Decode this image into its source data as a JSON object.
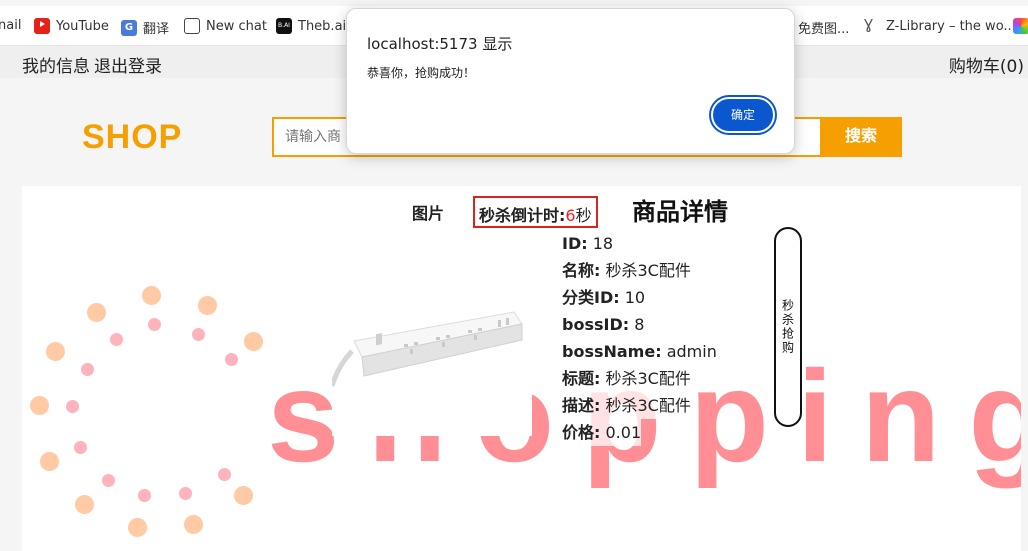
{
  "bookmarks": [
    {
      "label": "nail",
      "icon": "none"
    },
    {
      "label": "YouTube",
      "icon": "youtube-icon"
    },
    {
      "label": "翻译",
      "icon": "translate-icon"
    },
    {
      "label": "New chat",
      "icon": "chatgpt-icon"
    },
    {
      "label": "Theb.ai",
      "icon": "theb-icon"
    },
    {
      "label": "免费图...",
      "icon": "none"
    },
    {
      "label": "Z-Library – the wo...",
      "icon": "zlibrary-icon"
    },
    {
      "label": "",
      "icon": "rainbow-icon"
    }
  ],
  "topnav": {
    "my_info": "我的信息",
    "logout": "退出登录",
    "cart": "购物车(0)"
  },
  "header": {
    "logo": "SHOP",
    "search_placeholder": "请输入商",
    "search_button": "搜索"
  },
  "watermark": "shopping",
  "product": {
    "pic_label": "图片",
    "countdown_label": "秒杀倒计时:",
    "countdown_value": "6",
    "countdown_unit": "秒",
    "detail_title": "商品详情",
    "fields": [
      {
        "key": "ID:",
        "value": "18"
      },
      {
        "key": "名称:",
        "value": "秒杀3C配件"
      },
      {
        "key": "分类ID:",
        "value": "10"
      },
      {
        "key": "bossID:",
        "value": "8"
      },
      {
        "key": "bossName:",
        "value": "admin"
      },
      {
        "key": "标题:",
        "value": "秒杀3C配件"
      },
      {
        "key": "描述:",
        "value": "秒杀3C配件"
      },
      {
        "key": "价格:",
        "value": "0.01"
      }
    ],
    "buy_button": "秒杀抢购"
  },
  "dialog": {
    "title": "localhost:5173 显示",
    "message": "恭喜你，抢购成功！",
    "ok": "确定"
  },
  "colors": {
    "brand": "#f5a000",
    "watermark": "#ff8a8f",
    "countdown": "#e22",
    "dialog_button": "#0b57d0"
  }
}
